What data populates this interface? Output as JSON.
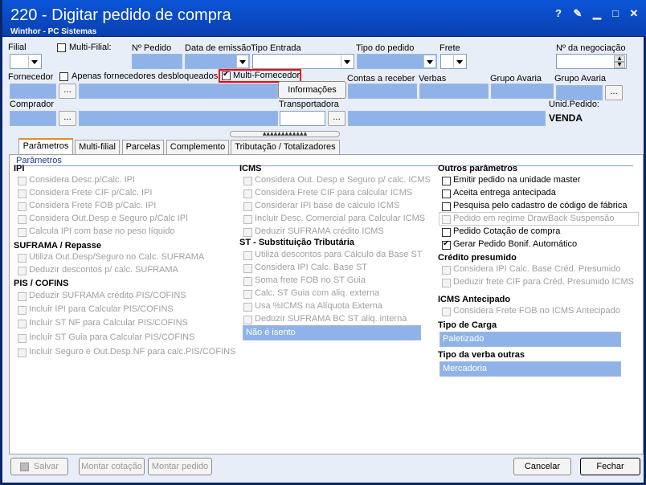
{
  "window": {
    "title": "220 - Digitar pedido de compra",
    "subtitle": "Winthor - PC Sistemas"
  },
  "fields": {
    "filial": "Filial",
    "multi_filial": "Multi-Filial:",
    "num_pedido": "Nº Pedido",
    "data_emissao": "Data de emissão",
    "tipo_entrada": "Tipo Entrada",
    "tipo_pedido": "Tipo do pedido",
    "frete": "Frete",
    "num_negociacao": "Nº da negociação",
    "fornecedor": "Fornecedor",
    "apenas_desbloqueados": "Apenas fornecedores desbloqueados",
    "multi_fornecedor": "Multi-Fornecedor",
    "contas_receber": "Contas a receber",
    "verbas": "Verbas",
    "grupo_avaria_1": "Grupo Avaria",
    "grupo_avaria_2": "Grupo Avaria",
    "informacoes": "Informações",
    "comprador": "Comprador",
    "transportadora": "Transportadora",
    "unid_pedido": "Unid.Pedido:",
    "unid_pedido_value": "VENDA"
  },
  "tabs": [
    "Parâmetros",
    "Multi-filial",
    "Parcelas",
    "Complemento",
    "Tributação / Totalizadores"
  ],
  "panel_title": "Parâmetros",
  "ipi": {
    "heading": "IPI",
    "items": [
      "Considera Desc.p/Calc. IPI",
      "Considera Frete CIF p/Calc. IPI",
      "Considera Frete FOB p/Calc. IPI",
      "Considera Out.Desp e Seguro p/Calc IPI",
      "Calcula IPI com base no peso líquido"
    ]
  },
  "suframa": {
    "heading": "SUFRAMA / Repasse",
    "items": [
      "Utiliza Out.Desp/Seguro no Calc. SUFRAMA",
      "Deduzir descontos p/ calc. SUFRAMA"
    ]
  },
  "pis": {
    "heading": "PIS / COFINS",
    "items": [
      "Deduzir SUFRAMA crédito PIS/COFINS",
      "Incluir IPI para Calcular PIS/COFINS",
      "Incluir ST NF para Calcular PIS/COFINS",
      "Incluir ST Guia para Calcular PIS/COFINS",
      "Incluir Seguro e Out.Desp.NF para calc.PIS/COFINS"
    ]
  },
  "icms": {
    "heading": "ICMS",
    "items": [
      "Considera Out. Desp e Seguro p/ calc. ICMS",
      "Considera Frete CIF para calcular ICMS",
      "Considerar IPI base de cálculo ICMS",
      "Incluir Desc. Comercial  para Calcular ICMS",
      "Deduzir SUFRAMA crédito ICMS"
    ]
  },
  "st": {
    "heading": "ST - Substituição Tributária",
    "items": [
      "Utiliza descontos para Cálculo da Base ST",
      "Considera IPI Calc. Base ST",
      "Soma frete FOB no ST Guia",
      "Calc. ST Guia com aliq. externa",
      "Usa %ICMS na Alíquota Externa",
      "Deduzir SUFRAMA BC ST aliq. interna"
    ],
    "select_value": "Não é isento"
  },
  "outros": {
    "heading": "Outros parâmetros",
    "items": [
      "Emitir pedido na unidade master",
      "Aceita entrega antecipada",
      "Pesquisa pelo cadastro de código de fábrica",
      "Pedido em regime DrawBack Suspensão",
      "Pedido Cotação de compra",
      "Gerar Pedido Bonif. Automático"
    ]
  },
  "credito": {
    "heading": "Crédito presumido",
    "items": [
      "Considera IPI Calc. Base Créd. Presumido",
      "Deduzir frete CIF para Créd. Presumido ICMS"
    ]
  },
  "icms_antecipado": {
    "heading": "ICMS Antecipado",
    "items": [
      "Considera Frete FOB no ICMS Antecipado"
    ]
  },
  "tipo_carga": {
    "heading": "Tipo de Carga",
    "value": "Paletizado"
  },
  "tipo_verba": {
    "heading": "Tipo da verba outras",
    "value": "Mercadoria"
  },
  "buttons": {
    "salvar": "Salvar",
    "montar_cotacao": "Montar cotação",
    "montar_pedido": "Montar pedido",
    "cancelar": "Cancelar",
    "fechar": "Fechar"
  },
  "colors": {
    "titlebar": "#0b55d8",
    "field": "#8fb3e8",
    "highlight": "#ff0000"
  }
}
